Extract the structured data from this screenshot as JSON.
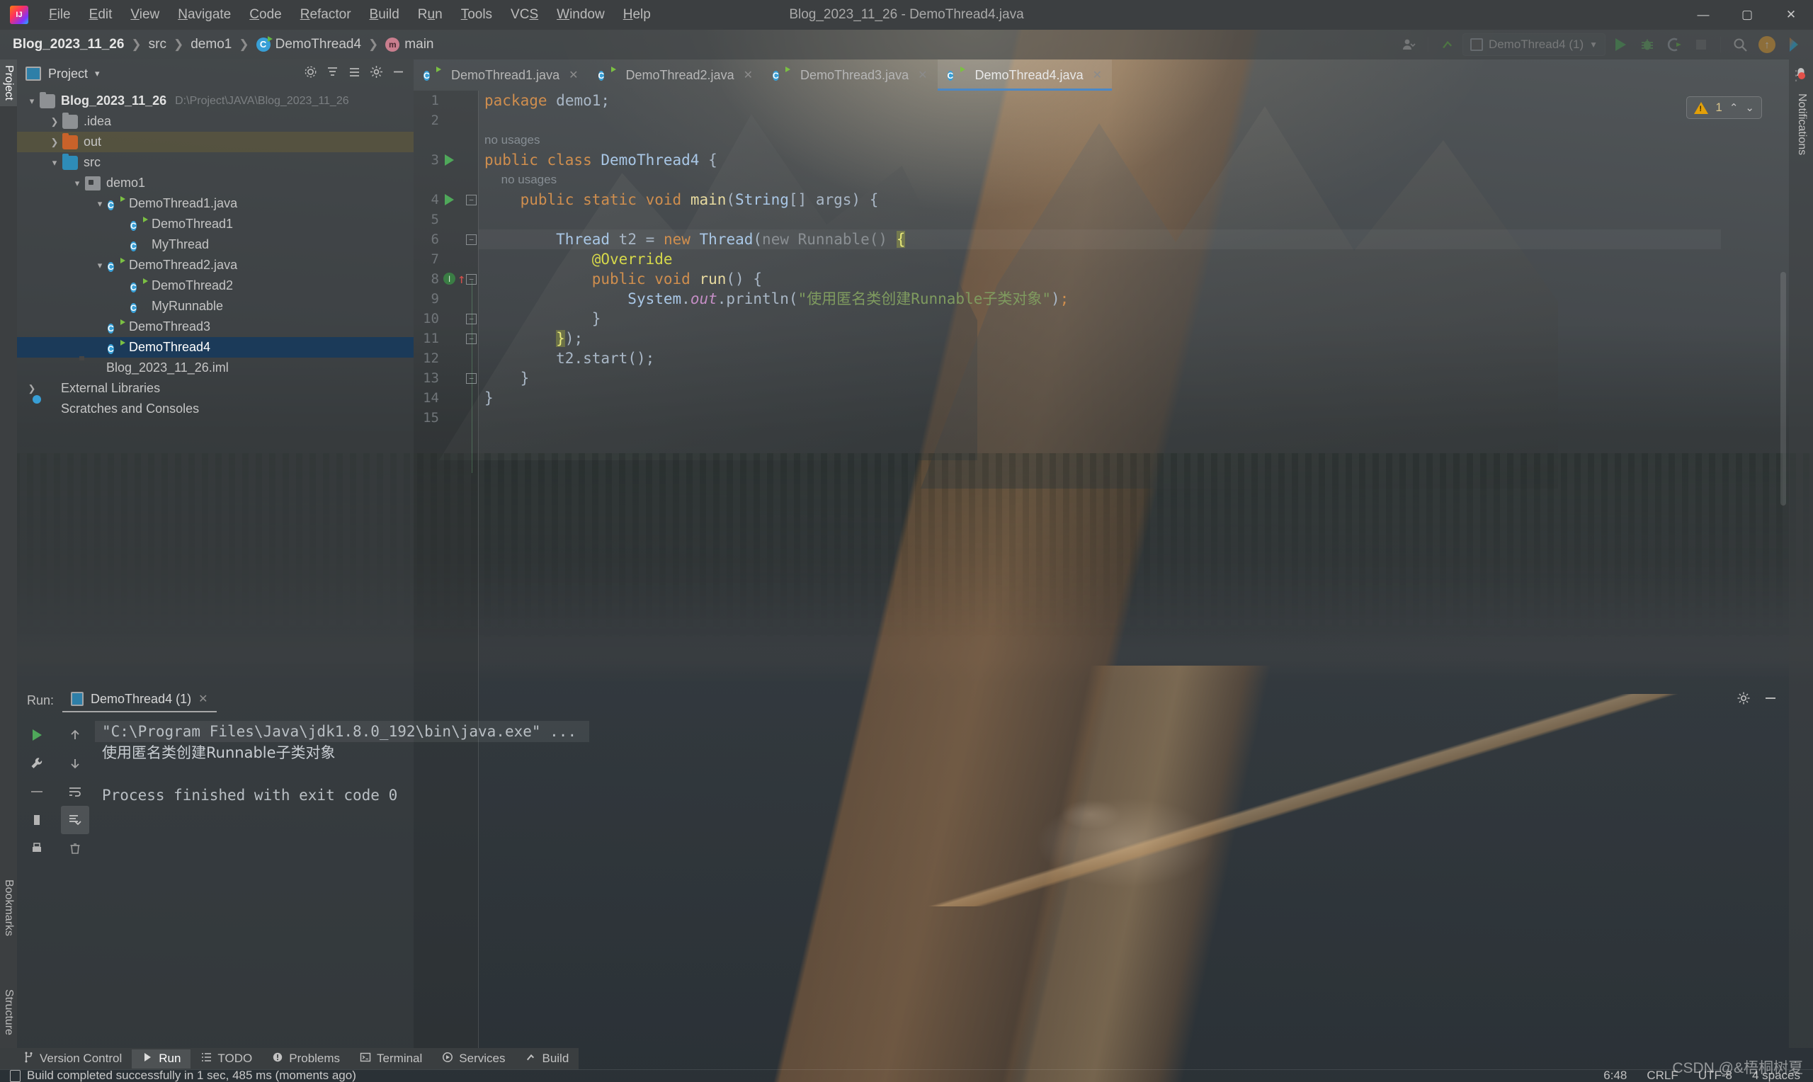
{
  "window": {
    "title": "Blog_2023_11_26 - DemoThread4.java",
    "minimize": "—",
    "maximize": "▢",
    "close": "✕"
  },
  "menubar": {
    "logo": "intellij-idea-logo",
    "items": [
      {
        "label": "File",
        "mnemonic": "F"
      },
      {
        "label": "Edit",
        "mnemonic": "E"
      },
      {
        "label": "View",
        "mnemonic": "V"
      },
      {
        "label": "Navigate",
        "mnemonic": "N"
      },
      {
        "label": "Code",
        "mnemonic": "C"
      },
      {
        "label": "Refactor",
        "mnemonic": "R"
      },
      {
        "label": "Build",
        "mnemonic": "B"
      },
      {
        "label": "Run",
        "mnemonic": "u"
      },
      {
        "label": "Tools",
        "mnemonic": "T"
      },
      {
        "label": "VCS",
        "mnemonic": "S"
      },
      {
        "label": "Window",
        "mnemonic": "W"
      },
      {
        "label": "Help",
        "mnemonic": "H"
      }
    ]
  },
  "breadcrumb": {
    "separator": "❯",
    "items": [
      {
        "label": "Blog_2023_11_26",
        "icon": null
      },
      {
        "label": "src",
        "icon": null
      },
      {
        "label": "demo1",
        "icon": null
      },
      {
        "label": "DemoThread4",
        "icon": "class-icon"
      },
      {
        "label": "main",
        "icon": "method-icon"
      }
    ]
  },
  "toolbar": {
    "account_icon": "account-icon",
    "vcs_icon": "vcs-update-icon",
    "run_config": "DemoThread4 (1)",
    "run_icon": "run-icon",
    "debug_icon": "debug-icon",
    "profile_icon": "run-with-coverage-icon",
    "stop_icon": "stop-icon",
    "search_icon": "search-icon",
    "update_icon": "update-available-icon",
    "ide_icon": "ide-feature-icon"
  },
  "left_strip": {
    "project_tab": "Project",
    "bookmarks_tab": "Bookmarks",
    "structure_tab": "Structure"
  },
  "right_strip": {
    "notifications_tab": "Notifications"
  },
  "project_panel": {
    "title": "Project",
    "caret": "▾",
    "actions": [
      "settings-icon",
      "collapse-all-icon",
      "expand-icon",
      "gear-icon",
      "hide-icon"
    ],
    "tree": [
      {
        "label": "Blog_2023_11_26",
        "path": "D:\\Project\\JAVA\\Blog_2023_11_26",
        "icon": "module-folder-icon",
        "arrow": "▾",
        "indent": 0,
        "bold": true,
        "state": "normal"
      },
      {
        "label": ".idea",
        "icon": "folder-gray-icon",
        "arrow": "❯",
        "indent": 1,
        "state": "normal"
      },
      {
        "label": "out",
        "icon": "folder-orange-icon",
        "arrow": "❯",
        "indent": 1,
        "state": "highlighted"
      },
      {
        "label": "src",
        "icon": "folder-blue-icon",
        "arrow": "▾",
        "indent": 1,
        "state": "normal"
      },
      {
        "label": "demo1",
        "icon": "package-icon",
        "arrow": "▾",
        "indent": 2,
        "state": "normal"
      },
      {
        "label": "DemoThread1.java",
        "icon": "java-runnable-class-icon",
        "arrow": "▾",
        "indent": 3,
        "state": "normal"
      },
      {
        "label": "DemoThread1",
        "icon": "java-runnable-class-icon",
        "arrow": "",
        "indent": 4,
        "state": "normal"
      },
      {
        "label": "MyThread",
        "icon": "java-class-icon",
        "arrow": "",
        "indent": 4,
        "state": "normal"
      },
      {
        "label": "DemoThread2.java",
        "icon": "java-runnable-class-icon",
        "arrow": "▾",
        "indent": 3,
        "state": "normal"
      },
      {
        "label": "DemoThread2",
        "icon": "java-runnable-class-icon",
        "arrow": "",
        "indent": 4,
        "state": "normal"
      },
      {
        "label": "MyRunnable",
        "icon": "java-class-icon",
        "arrow": "",
        "indent": 4,
        "state": "normal"
      },
      {
        "label": "DemoThread3",
        "icon": "java-runnable-class-icon",
        "arrow": "",
        "indent": 3,
        "state": "normal"
      },
      {
        "label": "DemoThread4",
        "icon": "java-runnable-class-icon",
        "arrow": "",
        "indent": 3,
        "state": "selected"
      },
      {
        "label": "Blog_2023_11_26.iml",
        "icon": "iml-file-icon",
        "arrow": "",
        "indent": 2,
        "state": "normal"
      },
      {
        "label": "External Libraries",
        "icon": "libraries-icon",
        "arrow": "❯",
        "indent": 0,
        "state": "normal"
      },
      {
        "label": "Scratches and Consoles",
        "icon": "scratches-icon",
        "arrow": "",
        "indent": 0,
        "state": "normal"
      }
    ]
  },
  "editor": {
    "tabs": [
      {
        "label": "DemoThread1.java",
        "active": false,
        "close": "✕"
      },
      {
        "label": "DemoThread2.java",
        "active": false,
        "close": "✕"
      },
      {
        "label": "DemoThread3.java",
        "active": false,
        "close": "✕"
      },
      {
        "label": "DemoThread4.java",
        "active": true,
        "close": "✕"
      }
    ],
    "more_icon": "more-options-icon",
    "warning_badge": {
      "count": "1",
      "up": "⌃",
      "down": "⌄"
    },
    "lines": [
      {
        "num": "1",
        "type": "code",
        "gutter": null,
        "fold": false
      },
      {
        "num": "2",
        "type": "code",
        "gutter": null,
        "fold": false
      },
      {
        "num": "",
        "type": "hint",
        "text": "no usages"
      },
      {
        "num": "3",
        "type": "code",
        "gutter": "run",
        "fold": false
      },
      {
        "num": "",
        "type": "hint",
        "text": "no usages"
      },
      {
        "num": "4",
        "type": "code",
        "gutter": "run",
        "fold": true
      },
      {
        "num": "5",
        "type": "code",
        "gutter": null,
        "fold": false
      },
      {
        "num": "6",
        "type": "code",
        "gutter": null,
        "fold": true
      },
      {
        "num": "7",
        "type": "code",
        "gutter": null,
        "fold": false
      },
      {
        "num": "8",
        "type": "code",
        "gutter": "implements",
        "fold": true
      },
      {
        "num": "9",
        "type": "code",
        "gutter": null,
        "fold": false
      },
      {
        "num": "10",
        "type": "code",
        "gutter": null,
        "fold": true
      },
      {
        "num": "11",
        "type": "code",
        "gutter": null,
        "fold": true
      },
      {
        "num": "12",
        "type": "code",
        "gutter": null,
        "fold": false
      },
      {
        "num": "13",
        "type": "code",
        "gutter": null,
        "fold": true
      },
      {
        "num": "14",
        "type": "code",
        "gutter": null,
        "fold": false
      },
      {
        "num": "15",
        "type": "code",
        "gutter": null,
        "fold": false
      }
    ],
    "source_text": [
      "package demo1;",
      "",
      "no usages",
      "public class DemoThread4 {",
      "no usages",
      "    public static void main(String[] args) {",
      "",
      "        Thread t2 = new Thread(new Runnable() {",
      "            @Override",
      "            public void run() {",
      "                System.out.println(\"使用匿名类创建Runnable子类对象\");",
      "            }",
      "        });",
      "        t2.start();",
      "    }",
      "}",
      ""
    ],
    "gutter_implements_icon": "I",
    "gutter_implements_arrow": "↑"
  },
  "run_panel": {
    "label": "Run:",
    "tab_title": "DemoThread4 (1)",
    "tab_close": "✕",
    "settings_icon": "gear-icon",
    "minimize_icon": "minimize-icon",
    "toolbar_icons": [
      "rerun-icon",
      "scroll-up-icon",
      "wrench-icon",
      "scroll-down-icon",
      "soft-wrap-icon",
      "scroll-to-end-icon",
      "print-icon",
      "clear-all-icon",
      "trash-icon"
    ],
    "output": [
      {
        "text": "\"C:\\Program Files\\Java\\jdk1.8.0_192\\bin\\java.exe\" ...",
        "style": "cmd"
      },
      {
        "text": "使用匿名类创建Runnable子类对象",
        "style": "zh"
      },
      {
        "text": "",
        "style": "plain"
      },
      {
        "text": "Process finished with exit code 0",
        "style": "plain"
      }
    ]
  },
  "statusbar": {
    "tools": [
      {
        "label": "Version Control",
        "icon": "branch-icon",
        "active": false
      },
      {
        "label": "Run",
        "icon": "run-icon",
        "active": true
      },
      {
        "label": "TODO",
        "icon": "todo-icon",
        "active": false
      },
      {
        "label": "Problems",
        "icon": "problems-icon",
        "active": false
      },
      {
        "label": "Terminal",
        "icon": "terminal-icon",
        "active": false
      },
      {
        "label": "Services",
        "icon": "services-icon",
        "active": false
      },
      {
        "label": "Build",
        "icon": "build-icon",
        "active": false
      }
    ],
    "message": "Build completed successfully in 1 sec, 485 ms (moments ago)",
    "message_icon": "build-status-icon",
    "caret_position": "6:48",
    "line_separator": "CRLF",
    "encoding": "UTF-8",
    "indent": "4 spaces",
    "watermark": "CSDN @&梧桐树夏"
  }
}
